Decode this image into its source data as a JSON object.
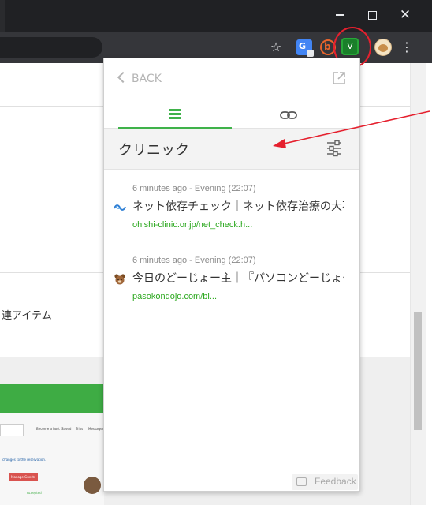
{
  "browser": {
    "minimize_glyph": "—",
    "close_glyph": "✕",
    "star_glyph": "☆",
    "menu_glyph": "⋮",
    "translate_letter": "G",
    "extension_b_letter": "b",
    "extension_v_letter": "V"
  },
  "page": {
    "related_items_label": "連アイテム",
    "thumbnail_nav": [
      "Become a host",
      "Saved",
      "Trips",
      "Messages"
    ],
    "thumbnail_small_text": "changes to the reservation.",
    "thumbnail_button": "Manage Guests",
    "thumbnail_status": "Accepted"
  },
  "popup": {
    "back_label": "BACK",
    "query": "クリニック",
    "results": [
      {
        "meta": "6 minutes ago - Evening (22:07)",
        "title": "ネット依存チェック｜ネット依存治療の大石クリニック",
        "url": "ohishi-clinic.or.jp/net_check.h...",
        "favicon": "blue-swirl-icon"
      },
      {
        "meta": "6 minutes ago - Evening (22:07)",
        "title": "今日のどーじょー主｜『パソコンどーじょー』",
        "url": "pasokondojo.com/bl...",
        "favicon": "bear-icon"
      }
    ],
    "feedback_label": "Feedback"
  },
  "colors": {
    "accent_green": "#3fb24a",
    "url_green": "#2ca81f",
    "annotation_red": "#e5202e",
    "chrome_dark": "#202124"
  }
}
